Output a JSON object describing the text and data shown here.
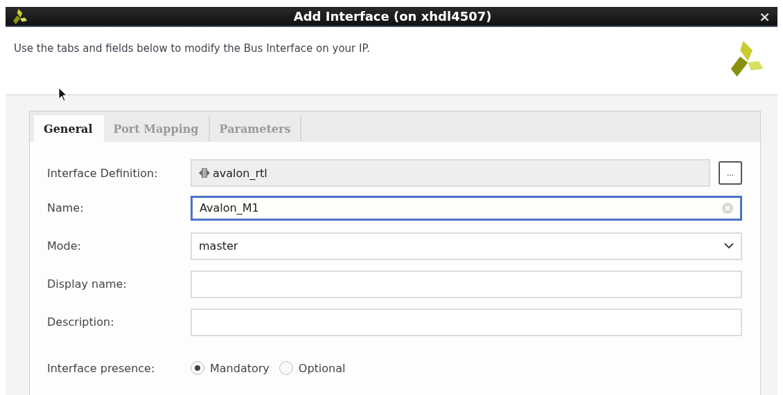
{
  "window": {
    "title": "Add Interface (on xhdl4507)",
    "close": "×"
  },
  "description": "Use the tabs and fields below to modify the Bus Interface on your IP.",
  "tabs": [
    {
      "label": "General",
      "selected": true
    },
    {
      "label": "Port Mapping",
      "selected": false
    },
    {
      "label": "Parameters",
      "selected": false
    }
  ],
  "fields": [
    {
      "kind": "readonly",
      "label": "Interface Definition:",
      "value": "avalon_rtl",
      "button": "..."
    },
    {
      "kind": "text",
      "label": "Name:",
      "value": "Avalon_M1",
      "focused": true
    },
    {
      "kind": "select",
      "label": "Mode:",
      "value": "master"
    },
    {
      "kind": "text",
      "label": "Display name:",
      "focused": false
    },
    {
      "kind": "text",
      "label": "Description:",
      "focused": false
    },
    {
      "kind": "radio",
      "label": "Interface presence:",
      "options": [
        {
          "label": "Mandatory",
          "selected": true
        },
        {
          "label": "Optional",
          "selected": false
        }
      ]
    }
  ]
}
